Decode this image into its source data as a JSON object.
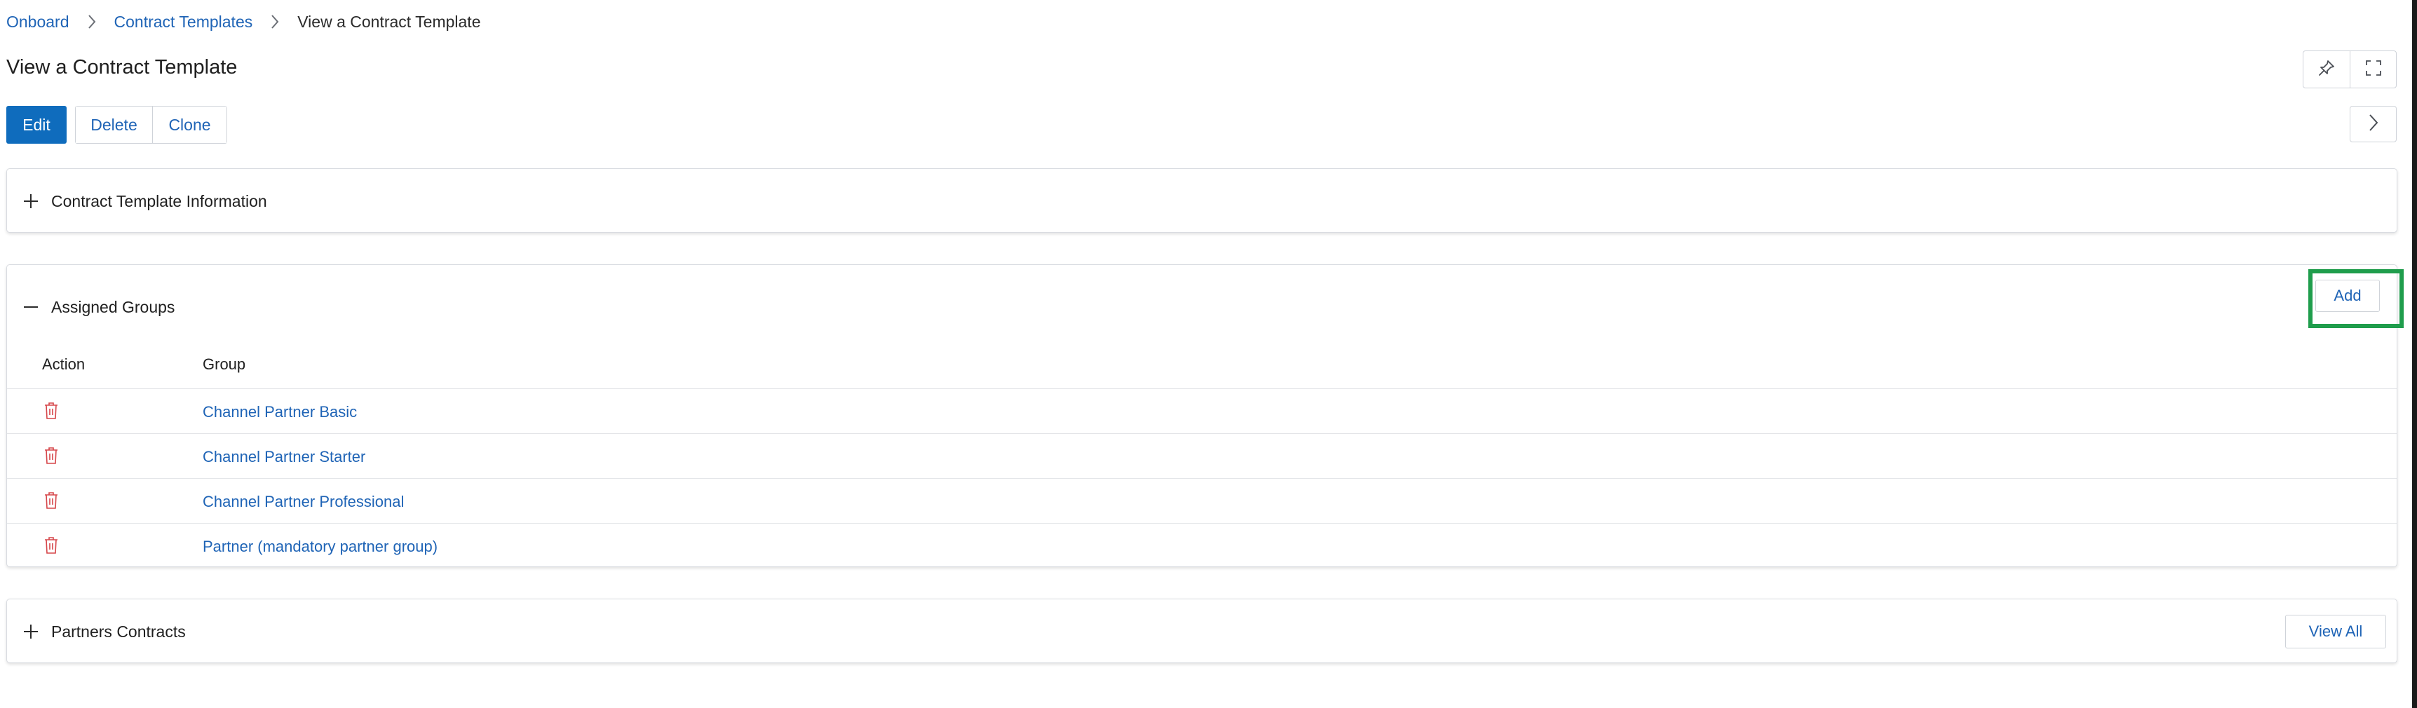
{
  "breadcrumb": {
    "items": [
      {
        "label": "Onboard"
      },
      {
        "label": "Contract Templates"
      },
      {
        "label": "View a Contract Template"
      }
    ]
  },
  "page": {
    "title": "View a Contract Template"
  },
  "toolbar": {
    "edit_label": "Edit",
    "delete_label": "Delete",
    "clone_label": "Clone"
  },
  "top_icons": [
    "pin-icon",
    "fullscreen-icon"
  ],
  "side_nav_icon": "chevron-right-icon",
  "panels": {
    "info": {
      "title": "Contract Template Information",
      "expanded": false
    },
    "groups": {
      "title": "Assigned Groups",
      "expanded": true,
      "add_label": "Add",
      "columns": [
        "Action",
        "Group"
      ],
      "rows": [
        {
          "group": "Channel Partner Basic"
        },
        {
          "group": "Channel Partner Starter"
        },
        {
          "group": "Channel Partner Professional"
        },
        {
          "group": "Partner (mandatory partner group)"
        }
      ]
    },
    "partners": {
      "title": "Partners Contracts",
      "expanded": false,
      "view_all_label": "View All"
    }
  },
  "colors": {
    "primary": "#0f6cbd",
    "link": "#1f64b6",
    "delete_icon": "#d6464a",
    "highlight": "#1f9d4c"
  }
}
